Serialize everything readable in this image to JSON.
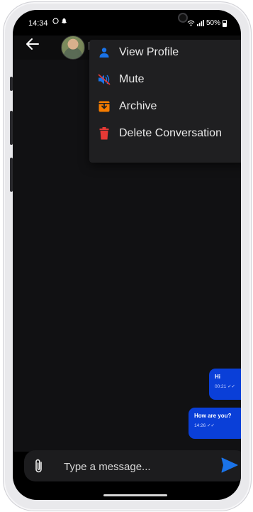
{
  "status_bar": {
    "time": "14:34",
    "battery": "50%"
  },
  "header": {
    "contact_initial": "I"
  },
  "menu": {
    "items": [
      {
        "label": "View Profile",
        "icon": "person-icon",
        "color": "#1a73e8"
      },
      {
        "label": "Mute",
        "icon": "mute-icon",
        "color": "#1a73e8"
      },
      {
        "label": "Archive",
        "icon": "archive-icon",
        "color": "#f57c00"
      },
      {
        "label": "Delete Conversation",
        "icon": "trash-icon",
        "color": "#e53935"
      }
    ]
  },
  "messages": [
    {
      "text": "Hi",
      "time": "00:21"
    },
    {
      "text": "How are you?",
      "time": "14:26"
    }
  ],
  "composer": {
    "placeholder": "Type a message..."
  },
  "colors": {
    "bubble": "#0a3fd8",
    "send": "#1a73e8"
  }
}
